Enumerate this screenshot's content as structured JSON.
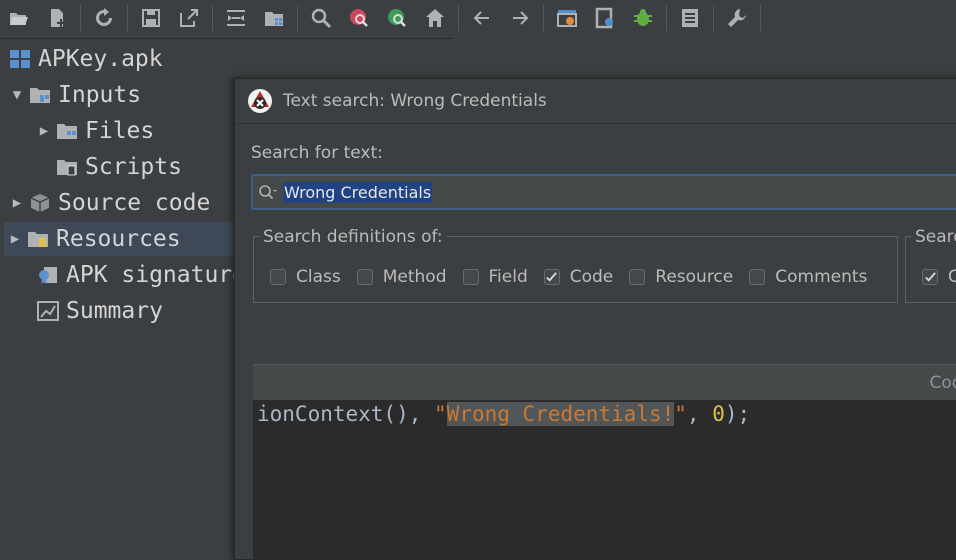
{
  "toolbar": {
    "buttons": [
      "open-icon",
      "add-files-icon",
      "reload-icon",
      "save-icon",
      "export-icon",
      "sync-icon",
      "project-icon",
      "search-icon",
      "usage-search-icon",
      "find-usage-icon",
      "home-icon",
      "back-icon",
      "forward-icon",
      "decompile-icon",
      "bookmark-icon",
      "debug-icon",
      "log-icon",
      "preferences-icon"
    ]
  },
  "tree": {
    "root": "APKey.apk",
    "items": [
      {
        "label": "Inputs",
        "arrow": "▼"
      },
      {
        "label": "Files",
        "arrow": "▶"
      },
      {
        "label": "Scripts",
        "arrow": ""
      },
      {
        "label": "Source code",
        "arrow": "▶"
      },
      {
        "label": "Resources",
        "arrow": "▶"
      },
      {
        "label": "APK signature",
        "arrow": ""
      },
      {
        "label": "Summary",
        "arrow": ""
      }
    ]
  },
  "dialog": {
    "title": "Text search: Wrong Credentials",
    "search_label": "Search for text:",
    "search_value": "Wrong Credentials",
    "definitions_title": "Search definitions of:",
    "options": [
      {
        "label": "Class",
        "checked": false
      },
      {
        "label": "Method",
        "checked": false
      },
      {
        "label": "Field",
        "checked": false
      },
      {
        "label": "Code",
        "checked": true
      },
      {
        "label": "Resource",
        "checked": false
      },
      {
        "label": "Comments",
        "checked": false
      }
    ],
    "second_group_title": "Searc",
    "second_group_option": "C",
    "results_column": "Code",
    "code_prefix": "ionContext(), ",
    "code_quote_open": "\"",
    "code_match": "Wrong Credentials!",
    "code_quote_close": "\"",
    "code_sep": ", ",
    "code_num": "0",
    "code_suffix": ");"
  }
}
